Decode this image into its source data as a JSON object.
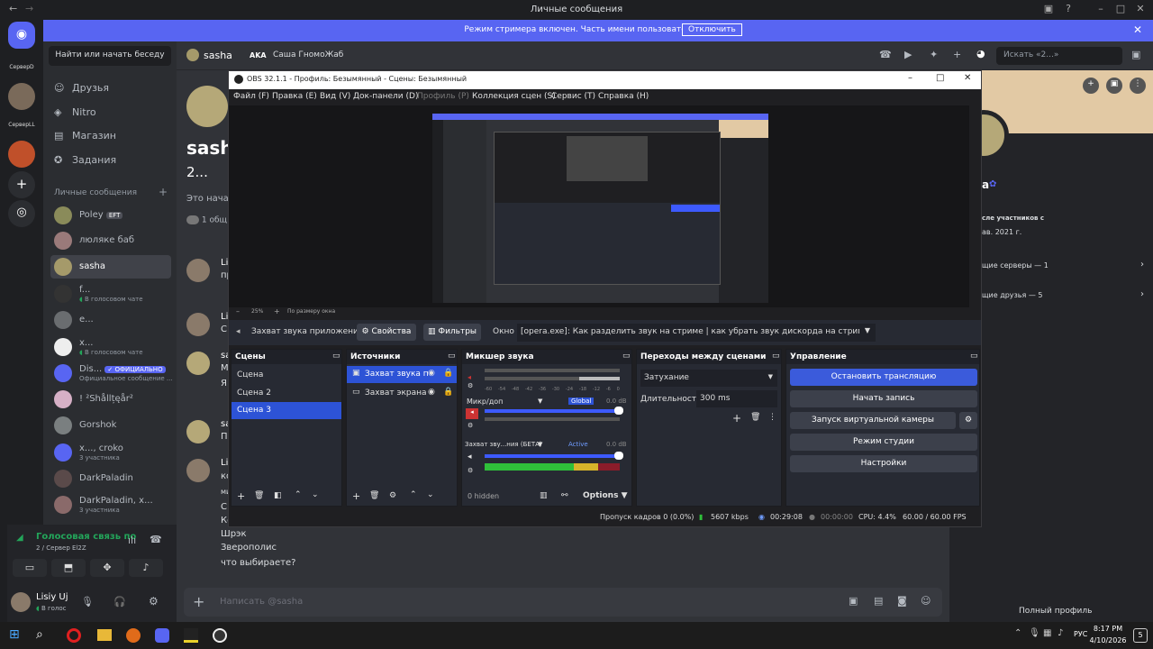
{
  "window": {
    "title": "Личные сообщения"
  },
  "banner": {
    "text": "Режим стримера включен. Часть имени пользователя скрыта.",
    "button": "Отключить"
  },
  "guilds": [
    {
      "label": "СерверD"
    },
    {
      "label": "СерверLL"
    }
  ],
  "dm_panel": {
    "search_placeholder": "Найти или начать беседу",
    "nav": [
      {
        "label": "Друзья"
      },
      {
        "label": "Nitro"
      },
      {
        "label": "Магазин"
      },
      {
        "label": "Задания"
      }
    ],
    "section_title": "Личные сообщения",
    "items": [
      {
        "name": "Poley",
        "badge": "EFT",
        "sub": ""
      },
      {
        "name": "люляке баб",
        "sub": ""
      },
      {
        "name": "sasha",
        "sub": ""
      },
      {
        "name": "f...",
        "sub": "В голосовом чате"
      },
      {
        "name": "e...",
        "sub": ""
      },
      {
        "name": "x...",
        "sub": "В голосовом чате"
      },
      {
        "name": "Dis...",
        "badge": "✓ ОФИЦИАЛЬНО",
        "sub": "Официальное сообщение ..."
      },
      {
        "name": "! ²Shållțęår²",
        "sub": ""
      },
      {
        "name": "Gorshok",
        "sub": ""
      },
      {
        "name": "x..., croko",
        "sub": "3 участника"
      },
      {
        "name": "DarkPaladin",
        "sub": ""
      },
      {
        "name": "DarkPaladin, x...",
        "sub": "3 участника"
      }
    ]
  },
  "voice": {
    "title": "Голосовая связь по",
    "sub": "2 / Сервер El2Z"
  },
  "user": {
    "name": "Lisiy Uj",
    "status": "В голос"
  },
  "chat": {
    "header_name": "sasha",
    "aka_label": "AKA",
    "aka_value": "Саша ГномоЖаб",
    "search_placeholder": "Искать «2...»",
    "intro_name": "sash",
    "intro_sub": "2...",
    "intro_text": "Это начал",
    "mutual": "1 общ",
    "messages": [
      "Li",
      "пр",
      "Li",
      "С",
      "sa",
      "М",
      "Я",
      "sa",
      "По",
      "Li",
      "ко",
      "ми",
      "С",
      "Ко",
      "Шрэк",
      "Зверополис",
      "что выбираете?"
    ],
    "input_placeholder": "Написать @sasha"
  },
  "profile": {
    "name_part": "а",
    "member_since_label": "сле участников с",
    "member_since": "ав. 2021 г.",
    "mutual_servers": "щие серверы — 1",
    "mutual_friends": "щие друзья — 5",
    "full_profile": "Полный профиль"
  },
  "obs": {
    "title": "OBS 32.1.1 - Профиль: Безымянный - Сцены: Безымянный",
    "menu": [
      "Файл (F)",
      "Правка (E)",
      "Вид (V)",
      "Док-панели (D)",
      "Профиль (P)",
      "Коллекция сцен (S)",
      "Сервис (T)",
      "Справка (H)"
    ],
    "zoom": "25%",
    "fit": "По размеру окна",
    "source_bar": {
      "source": "Захват звука приложения",
      "properties": "Свойства",
      "filters": "Фильтры",
      "window_label": "Окно",
      "window_value": "[opera.exe]: Как разделить звук на стриме | как убрать звук дискорда на стриме | убрать з"
    },
    "scenes": {
      "title": "Сцены",
      "items": [
        "Сцена",
        "Сцена 2",
        "Сцена 3"
      ]
    },
    "sources": {
      "title": "Источники",
      "items": [
        "Захват звука пр",
        "Захват экрана"
      ]
    },
    "mixer": {
      "title": "Микшер звука",
      "tracks": [
        {
          "name": "Микр/доп",
          "tag": "Global",
          "db": "0.0 dB"
        },
        {
          "name": "Захват зву...ния (БЕТА)",
          "tag": "Active",
          "db": "0.0 dB"
        }
      ],
      "scale": [
        "-60",
        "-54",
        "-48",
        "-42",
        "-36",
        "-30",
        "-24",
        "-18",
        "-12",
        "-6",
        "0"
      ],
      "hidden": "0 hidden",
      "options": "Options"
    },
    "transitions": {
      "title": "Переходы между сценами",
      "type": "Затухание",
      "duration_label": "Длительность",
      "duration": "300 ms"
    },
    "controls": {
      "title": "Управление",
      "buttons": [
        "Остановить трансляцию",
        "Начать запись",
        "Запуск виртуальной камеры",
        "Режим студии",
        "Настройки"
      ]
    },
    "status": {
      "dropped": "Пропуск кадров 0 (0.0%)",
      "bitrate": "5607 kbps",
      "stream_time": "00:29:08",
      "rec_time": "00:00:00",
      "cpu": "CPU: 4.4%",
      "fps": "60.00 / 60.00 FPS"
    }
  },
  "taskbar": {
    "lang": "РУС",
    "time": "8:17 PM",
    "date": "4/10/2026",
    "notif": "5"
  }
}
